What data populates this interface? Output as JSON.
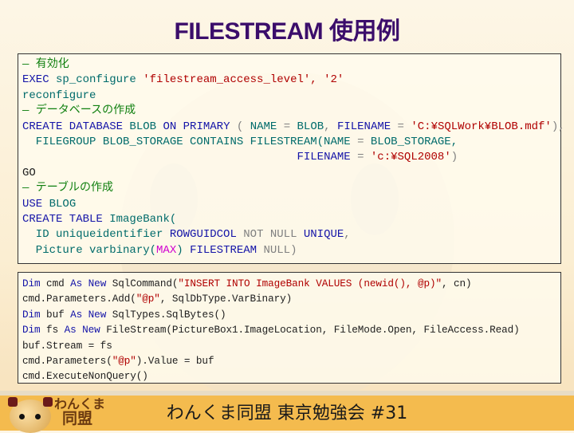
{
  "title": "FILESTREAM 使用例",
  "colors": {
    "keyword": "#1414a8",
    "identifier": "#006b6b",
    "string": "#b00000",
    "comment": "#108010",
    "operator": "#808080",
    "function": "#d000d0",
    "title": "#3b0d6b",
    "band": "#f4bb4e"
  },
  "sql_block": [
    [
      [
        "c",
        "— 有効化"
      ]
    ],
    [
      [
        "k",
        "EXEC"
      ],
      [
        "t",
        " sp_configure "
      ],
      [
        "s",
        "'filestream_access_level', '2'"
      ]
    ],
    [
      [
        "t",
        "reconfigure"
      ]
    ],
    [
      [
        "c",
        "— データベースの作成"
      ]
    ],
    [
      [
        "k",
        "CREATE DATABASE"
      ],
      [
        "t",
        " BLOB "
      ],
      [
        "k",
        "ON PRIMARY"
      ],
      [
        "g",
        " ( "
      ],
      [
        "t",
        "NAME "
      ],
      [
        "g",
        "= "
      ],
      [
        "t",
        "BLOB"
      ],
      [
        "g",
        ", "
      ],
      [
        "k",
        "FILENAME"
      ],
      [
        "g",
        " = "
      ],
      [
        "s",
        "'C:¥SQLWork¥BLOB.mdf'"
      ],
      [
        "g",
        "),"
      ]
    ],
    [
      [
        "t",
        "  FILEGROUP BLOB_STORAGE CONTAINS FILESTREAM(NAME"
      ],
      [
        "g",
        " = "
      ],
      [
        "t",
        "BLOB_STORAGE,"
      ]
    ],
    [
      [
        "d",
        "                                         "
      ],
      [
        "k",
        "FILENAME"
      ],
      [
        "g",
        " = "
      ],
      [
        "s",
        "'c:¥SQL2008'"
      ],
      [
        "g",
        ")"
      ]
    ],
    [
      [
        "d",
        "GO"
      ]
    ],
    [
      [
        "c",
        "— テーブルの作成"
      ]
    ],
    [
      [
        "k",
        "USE"
      ],
      [
        "t",
        " BLOG"
      ]
    ],
    [
      [
        "k",
        "CREATE TABLE"
      ],
      [
        "t",
        " ImageBank("
      ]
    ],
    [
      [
        "t",
        "  ID uniqueidentifier "
      ],
      [
        "k",
        "ROWGUIDCOL"
      ],
      [
        "g",
        " NOT NULL "
      ],
      [
        "k",
        "UNIQUE"
      ],
      [
        "g",
        ","
      ]
    ],
    [
      [
        "t",
        "  Picture varbinary("
      ],
      [
        "m",
        "MAX"
      ],
      [
        "t",
        ") "
      ],
      [
        "k",
        "FILESTREAM"
      ],
      [
        "g",
        " NULL)"
      ]
    ]
  ],
  "vb_block": [
    [
      [
        "k",
        "Dim"
      ],
      [
        "d",
        " cmd "
      ],
      [
        "k",
        "As New"
      ],
      [
        "d",
        " SqlCommand("
      ],
      [
        "s",
        "\"INSERT INTO ImageBank VALUES (newid(), @p)\""
      ],
      [
        "d",
        ", cn)"
      ]
    ],
    [
      [
        "d",
        "cmd.Parameters.Add("
      ],
      [
        "s",
        "\"@p\""
      ],
      [
        "d",
        ", SqlDbType.VarBinary)"
      ]
    ],
    [
      [
        "k",
        "Dim"
      ],
      [
        "d",
        " buf "
      ],
      [
        "k",
        "As New"
      ],
      [
        "d",
        " SqlTypes.SqlBytes()"
      ]
    ],
    [
      [
        "k",
        "Dim"
      ],
      [
        "d",
        " fs "
      ],
      [
        "k",
        "As New"
      ],
      [
        "d",
        " FileStream(PictureBox1.ImageLocation, FileMode.Open, FileAccess.Read)"
      ]
    ],
    [
      [
        "d",
        "buf.Stream = fs"
      ]
    ],
    [
      [
        "d",
        "cmd.Parameters("
      ],
      [
        "s",
        "\"@p\""
      ],
      [
        "d",
        ").Value = buf"
      ]
    ],
    [
      [
        "d",
        "cmd.ExecuteNonQuery()"
      ]
    ]
  ],
  "footer": {
    "text": "わんくま同盟 東京勉強会 #31",
    "logo_line1": "わんくま",
    "logo_line2": "同盟"
  }
}
